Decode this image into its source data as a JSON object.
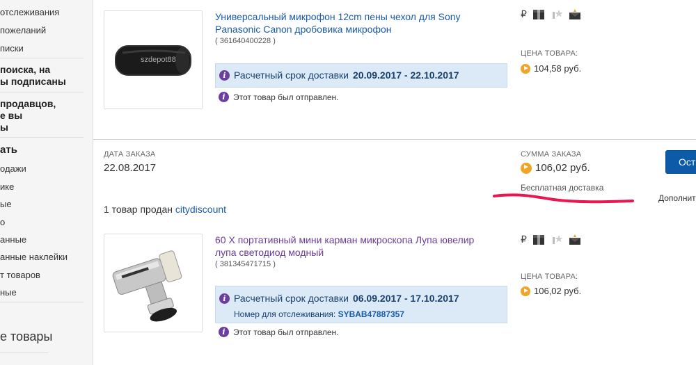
{
  "sidebar": {
    "items": [
      "отслеживания",
      "пожеланий",
      "писки"
    ],
    "head1": [
      "поиска, на",
      "ы подписаны"
    ],
    "head2": [
      "продавцов,",
      "е вы",
      "ы"
    ],
    "section_title": "ать",
    "items2": [
      "одажи",
      "ике",
      "ые",
      "о",
      "анные",
      "анные наклейки",
      "т товаров",
      "ные"
    ],
    "bottom_title": "е товары"
  },
  "orders": [
    {
      "item": {
        "title_line1": "Универсальный микрофон 12cm пены чехол для Sony",
        "title_line2": "Panasonic Canon дробовика микрофон",
        "id": "( 361640400228 )",
        "image_watermark": "szdepot88",
        "delivery_label": "Расчетный срок доставки",
        "delivery_dates": "20.09.2017 - 22.10.2017",
        "status": "Этот товар был отправлен.",
        "price_label": "ЦЕНА ТОВАРА:",
        "price": "104,58 руб."
      }
    },
    {
      "order_date_label": "ДАТА ЗАКАЗА",
      "order_date": "22.08.2017",
      "sum_label": "СУММА ЗАКАЗА",
      "sum": "106,02 руб.",
      "free_shipping": "Бесплатная доставка",
      "sold_by_prefix": "1 товар продан",
      "seller": "citydiscount",
      "button_label": "Ост",
      "more_link": "Дополнит",
      "item": {
        "title_line1": "60 X портативный мини карман микроскопа Лупа ювелир",
        "title_line2": "лупа светодиод модный",
        "id": "( 381345471715 )",
        "delivery_label": "Расчетный срок доставки",
        "delivery_dates": "06.09.2017 - 17.10.2017",
        "tracking_label": "Номер для отслеживания:",
        "tracking_number": "SYBAB47887357",
        "status": "Этот товар был отправлен.",
        "price_label": "ЦЕНА ТОВАРА:",
        "price": "106,02 руб."
      }
    }
  ],
  "icons": {
    "currency": "₽",
    "row": [
      "payment-icon",
      "package-icon",
      "feedback-icon",
      "mail-icon"
    ]
  },
  "colors": {
    "link": "#1a5ba8",
    "visited_link": "#6a3d9a",
    "delivery_bg": "#dbeaf6",
    "accent_button": "#0c5ba8",
    "price_coin": "#f0a42b",
    "info_icon": "#6b3fa0",
    "annotation_stroke": "#e8174f"
  }
}
